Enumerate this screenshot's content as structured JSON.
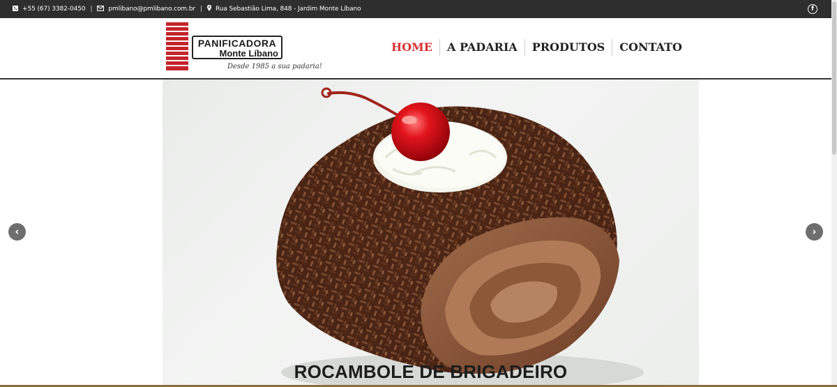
{
  "topbar": {
    "phone": "+55 (67) 3382-0450",
    "email": "pmlibano@pmlibano.com.br",
    "address": "Rua Sebastião Lima, 848 - Jardim Monte Líbano",
    "separator": "|",
    "icons": {
      "phone": "phone-icon",
      "email": "envelope-icon",
      "address": "map-marker-icon",
      "social": "facebook-icon"
    }
  },
  "logo": {
    "line1": "PANIFICADORA",
    "line2": "Monte Líbano",
    "tagline": "Desde 1985 a sua padaria!",
    "accent_color": "#c4242b"
  },
  "nav": {
    "items": [
      {
        "label": "HOME",
        "active": true
      },
      {
        "label": "A PADARIA",
        "active": false
      },
      {
        "label": "PRODUTOS",
        "active": false
      },
      {
        "label": "CONTATO",
        "active": false
      }
    ],
    "active_color": "#d9302f"
  },
  "slider": {
    "caption": "ROCAMBOLE DE BRIGADEIRO",
    "prev_icon": "chevron-left-icon",
    "next_icon": "chevron-right-icon",
    "prev_glyph": "‹",
    "next_glyph": "›"
  }
}
